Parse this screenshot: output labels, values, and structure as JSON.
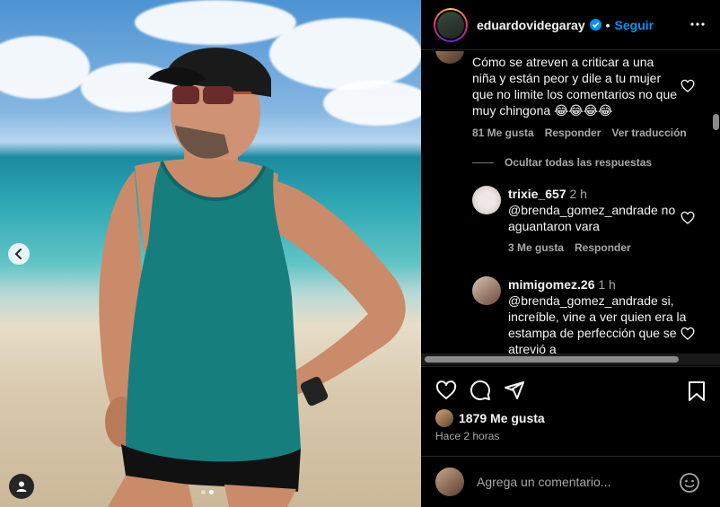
{
  "header": {
    "username": "eduardovidegaray",
    "separator": "•",
    "follow_label": "Seguir",
    "more_icon": "more-horizontal-icon"
  },
  "comments": {
    "main": {
      "text": "Cómo se atreven a criticar a una niña y están peor y dile a tu mujer que no limite los comentarios no que muy chingona 😂😂😂😂",
      "likes": "81 Me gusta",
      "reply_label": "Responder",
      "translate_label": "Ver traducción"
    },
    "hide_replies_label": "Ocultar todas las respuestas",
    "replies": [
      {
        "username": "trixie_657",
        "time": "2 h",
        "text": "@brenda_gomez_andrade no aguantaron vara",
        "likes": "3 Me gusta",
        "reply_label": "Responder"
      },
      {
        "username": "mimigomez.26",
        "time": "1 h",
        "text": "@brenda_gomez_andrade si, increíble, vine a ver quien era la estampa de perfección que se atrevió a"
      }
    ]
  },
  "post": {
    "likes": "1879 Me gusta",
    "posted": "Hace 2 horas"
  },
  "composer": {
    "placeholder": "Agrega un comentario..."
  },
  "colors": {
    "accent": "#0095f6",
    "background": "#000000",
    "secondary_text": "#a8a8a8"
  },
  "carousel": {
    "current_slide": 2,
    "total_slides": 2
  }
}
